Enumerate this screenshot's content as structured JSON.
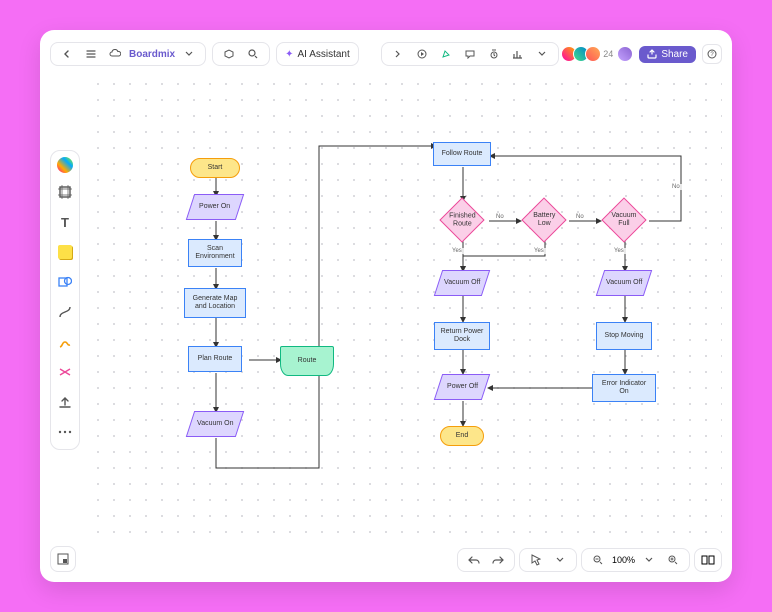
{
  "header": {
    "title": "Boardmix",
    "ai_button": "AI Assistant",
    "share_label": "Share",
    "avatar_count": "24",
    "zoom": "100%"
  },
  "flowchart": {
    "nodes": {
      "start": "Start",
      "power_on": "Power On",
      "scan_env": "Scan Environment",
      "gen_map": "Generate Map and Location",
      "plan_route": "Plan Route",
      "route_doc": "Route",
      "vacuum_on": "Vacuum On",
      "follow_route": "Follow Route",
      "finished_route": "Finished Route",
      "battery_low": "Battery Low",
      "vacuum_full": "Vacuum Full",
      "vacuum_off_1": "Vacuum Off",
      "return_dock": "Return Power Dock",
      "power_off": "Power Off",
      "end": "End",
      "vacuum_off_2": "Vacuum Off",
      "stop_moving": "Stop Moving",
      "error_ind": "Error Indicator On"
    },
    "labels": {
      "yes": "Yes",
      "no": "No"
    }
  },
  "chart_data": {
    "type": "flowchart",
    "nodes": [
      {
        "id": "start",
        "label": "Start",
        "kind": "terminal"
      },
      {
        "id": "power_on",
        "label": "Power On",
        "kind": "io"
      },
      {
        "id": "scan_env",
        "label": "Scan Environment",
        "kind": "process"
      },
      {
        "id": "gen_map",
        "label": "Generate Map and Location",
        "kind": "process"
      },
      {
        "id": "plan_route",
        "label": "Plan Route",
        "kind": "process"
      },
      {
        "id": "route_doc",
        "label": "Route",
        "kind": "document"
      },
      {
        "id": "vacuum_on",
        "label": "Vacuum On",
        "kind": "io"
      },
      {
        "id": "follow_route",
        "label": "Follow Route",
        "kind": "process"
      },
      {
        "id": "finished_route",
        "label": "Finished Route",
        "kind": "decision"
      },
      {
        "id": "battery_low",
        "label": "Battery Low",
        "kind": "decision"
      },
      {
        "id": "vacuum_full",
        "label": "Vacuum Full",
        "kind": "decision"
      },
      {
        "id": "vacuum_off_1",
        "label": "Vacuum Off",
        "kind": "io"
      },
      {
        "id": "return_dock",
        "label": "Return Power Dock",
        "kind": "process"
      },
      {
        "id": "power_off",
        "label": "Power Off",
        "kind": "io"
      },
      {
        "id": "end",
        "label": "End",
        "kind": "terminal"
      },
      {
        "id": "vacuum_off_2",
        "label": "Vacuum Off",
        "kind": "io"
      },
      {
        "id": "stop_moving",
        "label": "Stop Moving",
        "kind": "process"
      },
      {
        "id": "error_ind",
        "label": "Error Indicator On",
        "kind": "process"
      }
    ],
    "edges": [
      {
        "from": "start",
        "to": "power_on"
      },
      {
        "from": "power_on",
        "to": "scan_env"
      },
      {
        "from": "scan_env",
        "to": "gen_map"
      },
      {
        "from": "gen_map",
        "to": "plan_route"
      },
      {
        "from": "plan_route",
        "to": "route_doc"
      },
      {
        "from": "plan_route",
        "to": "vacuum_on"
      },
      {
        "from": "vacuum_on",
        "to": "follow_route"
      },
      {
        "from": "follow_route",
        "to": "finished_route"
      },
      {
        "from": "finished_route",
        "to": "battery_low",
        "label": "No"
      },
      {
        "from": "finished_route",
        "to": "vacuum_off_1",
        "label": "Yes"
      },
      {
        "from": "battery_low",
        "to": "vacuum_full",
        "label": "No"
      },
      {
        "from": "battery_low",
        "to": "vacuum_off_1",
        "label": "Yes"
      },
      {
        "from": "vacuum_full",
        "to": "follow_route",
        "label": "No"
      },
      {
        "from": "vacuum_full",
        "to": "vacuum_off_2",
        "label": "Yes"
      },
      {
        "from": "vacuum_off_1",
        "to": "return_dock"
      },
      {
        "from": "return_dock",
        "to": "power_off"
      },
      {
        "from": "power_off",
        "to": "end"
      },
      {
        "from": "vacuum_off_2",
        "to": "stop_moving"
      },
      {
        "from": "stop_moving",
        "to": "error_ind"
      },
      {
        "from": "error_ind",
        "to": "power_off"
      }
    ]
  }
}
